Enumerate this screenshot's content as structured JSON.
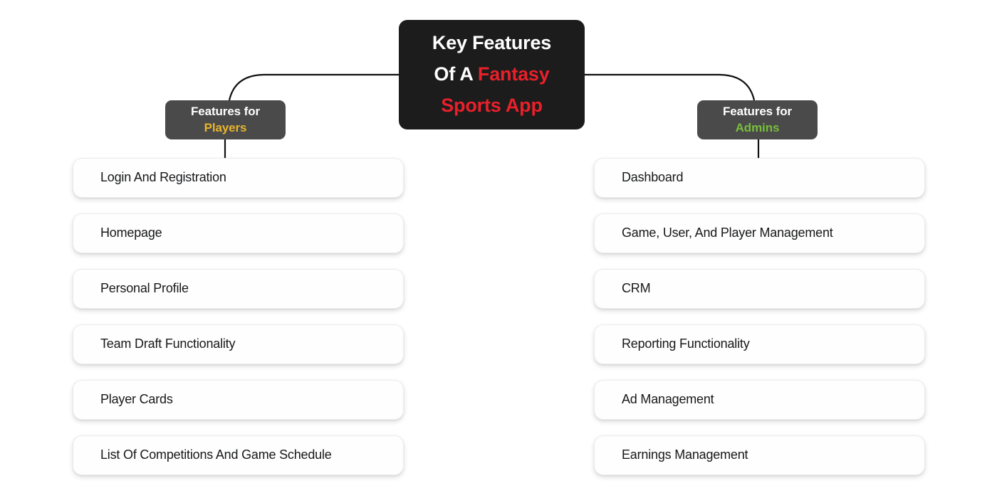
{
  "diagram": {
    "root": {
      "line1_plain": "Key Features",
      "line2_plain": "Of A ",
      "line2_accent": "Fantasy",
      "line3_accent": "Sports App",
      "accent_color": "#e8202a",
      "background_color": "#1c1c1c",
      "text_color": "#ffffff"
    },
    "branches": [
      {
        "header_line1": "Features for",
        "header_line2": "Players",
        "header_accent_color": "#e8b52b",
        "header_background": "#4a4a4a",
        "items": [
          "Login And Registration",
          "Homepage",
          "Personal Profile",
          "Team Draft Functionality",
          "Player Cards",
          "List Of Competitions And Game Schedule"
        ]
      },
      {
        "header_line1": "Features for",
        "header_line2": "Admins",
        "header_accent_color": "#78be3c",
        "header_background": "#4a4a4a",
        "items": [
          "Dashboard",
          "Game, User, And Player Management",
          "CRM",
          "Reporting Functionality",
          "Ad Management",
          "Earnings Management"
        ]
      }
    ]
  }
}
